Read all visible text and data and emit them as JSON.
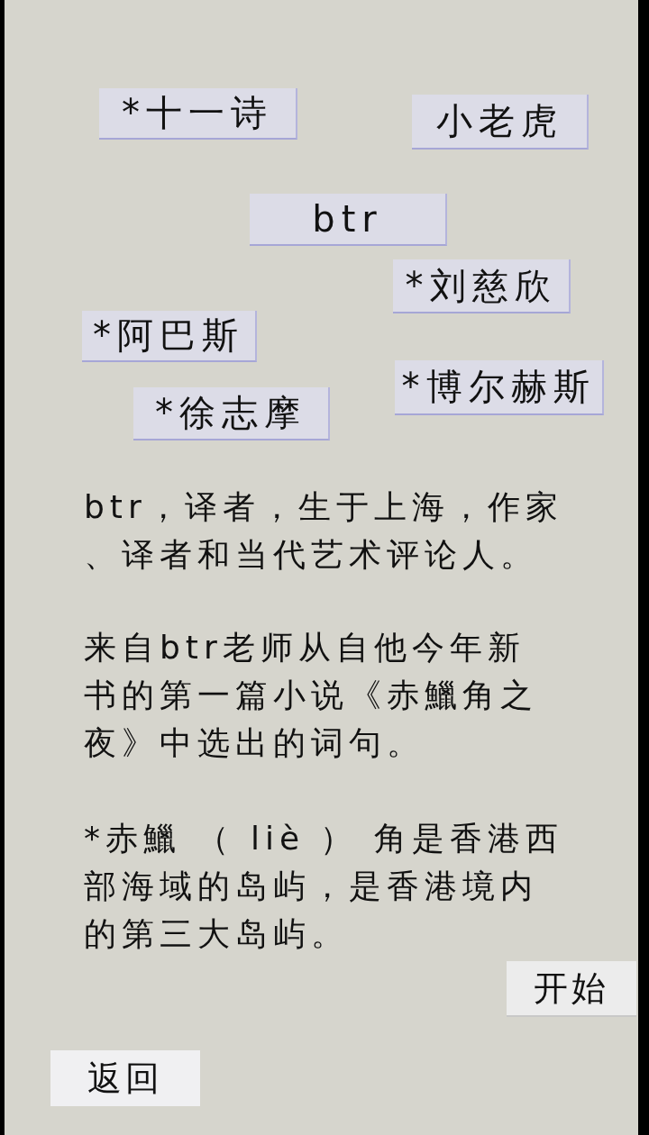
{
  "tags": [
    "*十一诗",
    "小老虎",
    "btr",
    "*刘慈欣",
    "*阿巴斯",
    "*博尔赫斯",
    "*徐志摩"
  ],
  "paragraphs": [
    "btr，译者，生于上海，作家、译者和当代艺术评论人。",
    "来自btr老师从自他今年新书的第一篇小说《赤鱲角之夜》中选出的词句。",
    "*赤鱲 （ liè ） 角是香港西部海域的岛屿，是香港境内的第三大岛屿。"
  ],
  "start_button": {
    "label": "开始"
  },
  "back_button": {
    "label": "返回"
  }
}
